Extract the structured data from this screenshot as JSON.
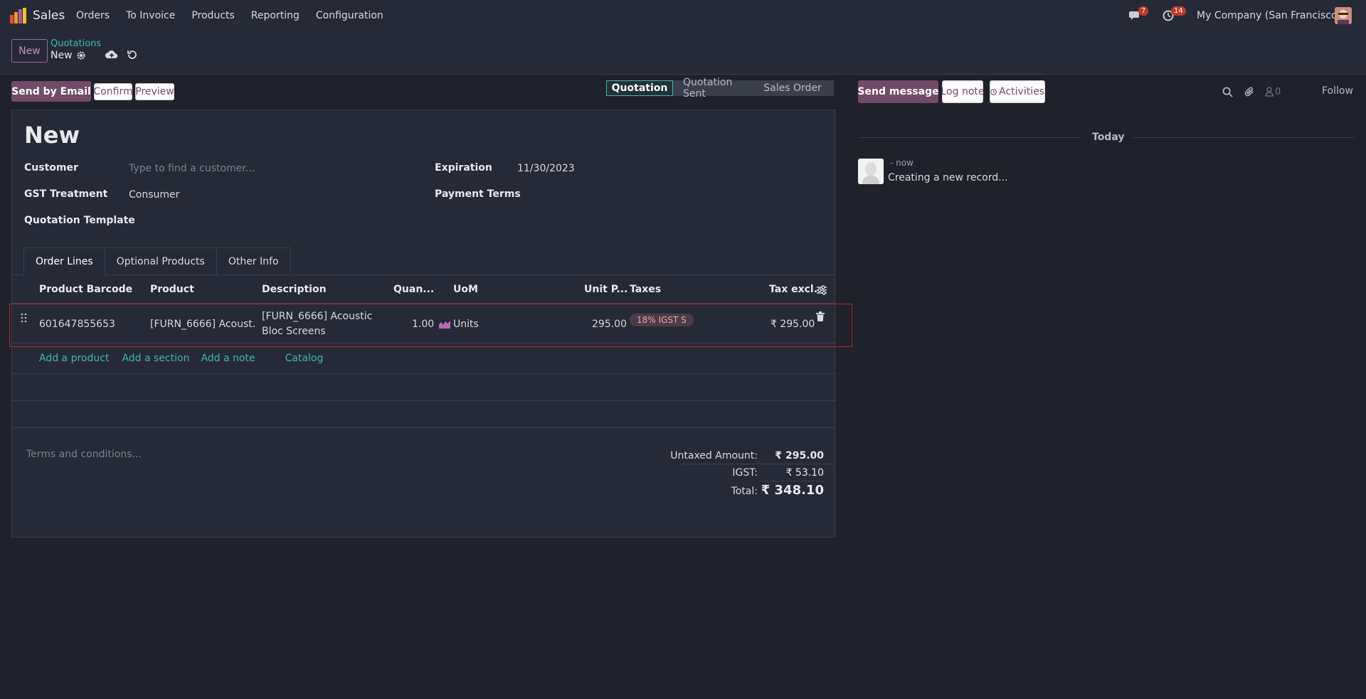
{
  "navbar": {
    "app_name": "Sales",
    "menu": [
      "Orders",
      "To Invoice",
      "Products",
      "Reporting",
      "Configuration"
    ],
    "messages_count": "7",
    "activities_count": "14",
    "company": "My Company (San Francisco)"
  },
  "control": {
    "new_label": "New",
    "breadcrumb_parent": "Quotations",
    "breadcrumb_current": "New"
  },
  "actions": {
    "send_email": "Send by Email",
    "confirm": "Confirm",
    "preview": "Preview"
  },
  "status": {
    "stages": [
      "Quotation",
      "Quotation Sent",
      "Sales Order"
    ],
    "active": "Quotation"
  },
  "form": {
    "title": "New",
    "customer_label": "Customer",
    "customer_placeholder": "Type to find a customer...",
    "gst_label": "GST Treatment",
    "gst_value": "Consumer",
    "template_label": "Quotation Template",
    "expiration_label": "Expiration",
    "expiration_value": "11/30/2023",
    "payment_terms_label": "Payment Terms"
  },
  "tabs": [
    "Order Lines",
    "Optional Products",
    "Other Info"
  ],
  "table": {
    "headers": {
      "barcode": "Product Barcode",
      "product": "Product",
      "description": "Description",
      "quantity": "Quan...",
      "uom": "UoM",
      "unit_price": "Unit P...",
      "taxes": "Taxes",
      "tax_excl": "Tax excl."
    },
    "rows": [
      {
        "barcode": "601647855653",
        "product": "[FURN_6666] Acoust...",
        "description_line1": "[FURN_6666] Acoustic",
        "description_line2": "Bloc Screens",
        "quantity": "1.00",
        "uom": "Units",
        "unit_price": "295.00",
        "tax": "18% IGST S",
        "subtotal": "₹ 295.00"
      }
    ],
    "add_links": [
      "Add a product",
      "Add a section",
      "Add a note",
      "Catalog"
    ]
  },
  "footer": {
    "terms_placeholder": "Terms and conditions...",
    "untaxed_label": "Untaxed Amount:",
    "untaxed_value": "₹ 295.00",
    "igst_label": "IGST:",
    "igst_value": "₹ 53.10",
    "total_label": "Total:",
    "total_value": "₹ 348.10"
  },
  "chatter": {
    "send_message": "Send message",
    "log_note": "Log note",
    "activities": "Activities",
    "followers_count": "0",
    "follow": "Follow",
    "today": "Today",
    "message_time": "- now",
    "message_body": "Creating a new record..."
  },
  "colors": {
    "primary": "#714b67",
    "accent": "#3fb8ae",
    "background": "#1f212b",
    "highlight_border": "#b5262c"
  }
}
